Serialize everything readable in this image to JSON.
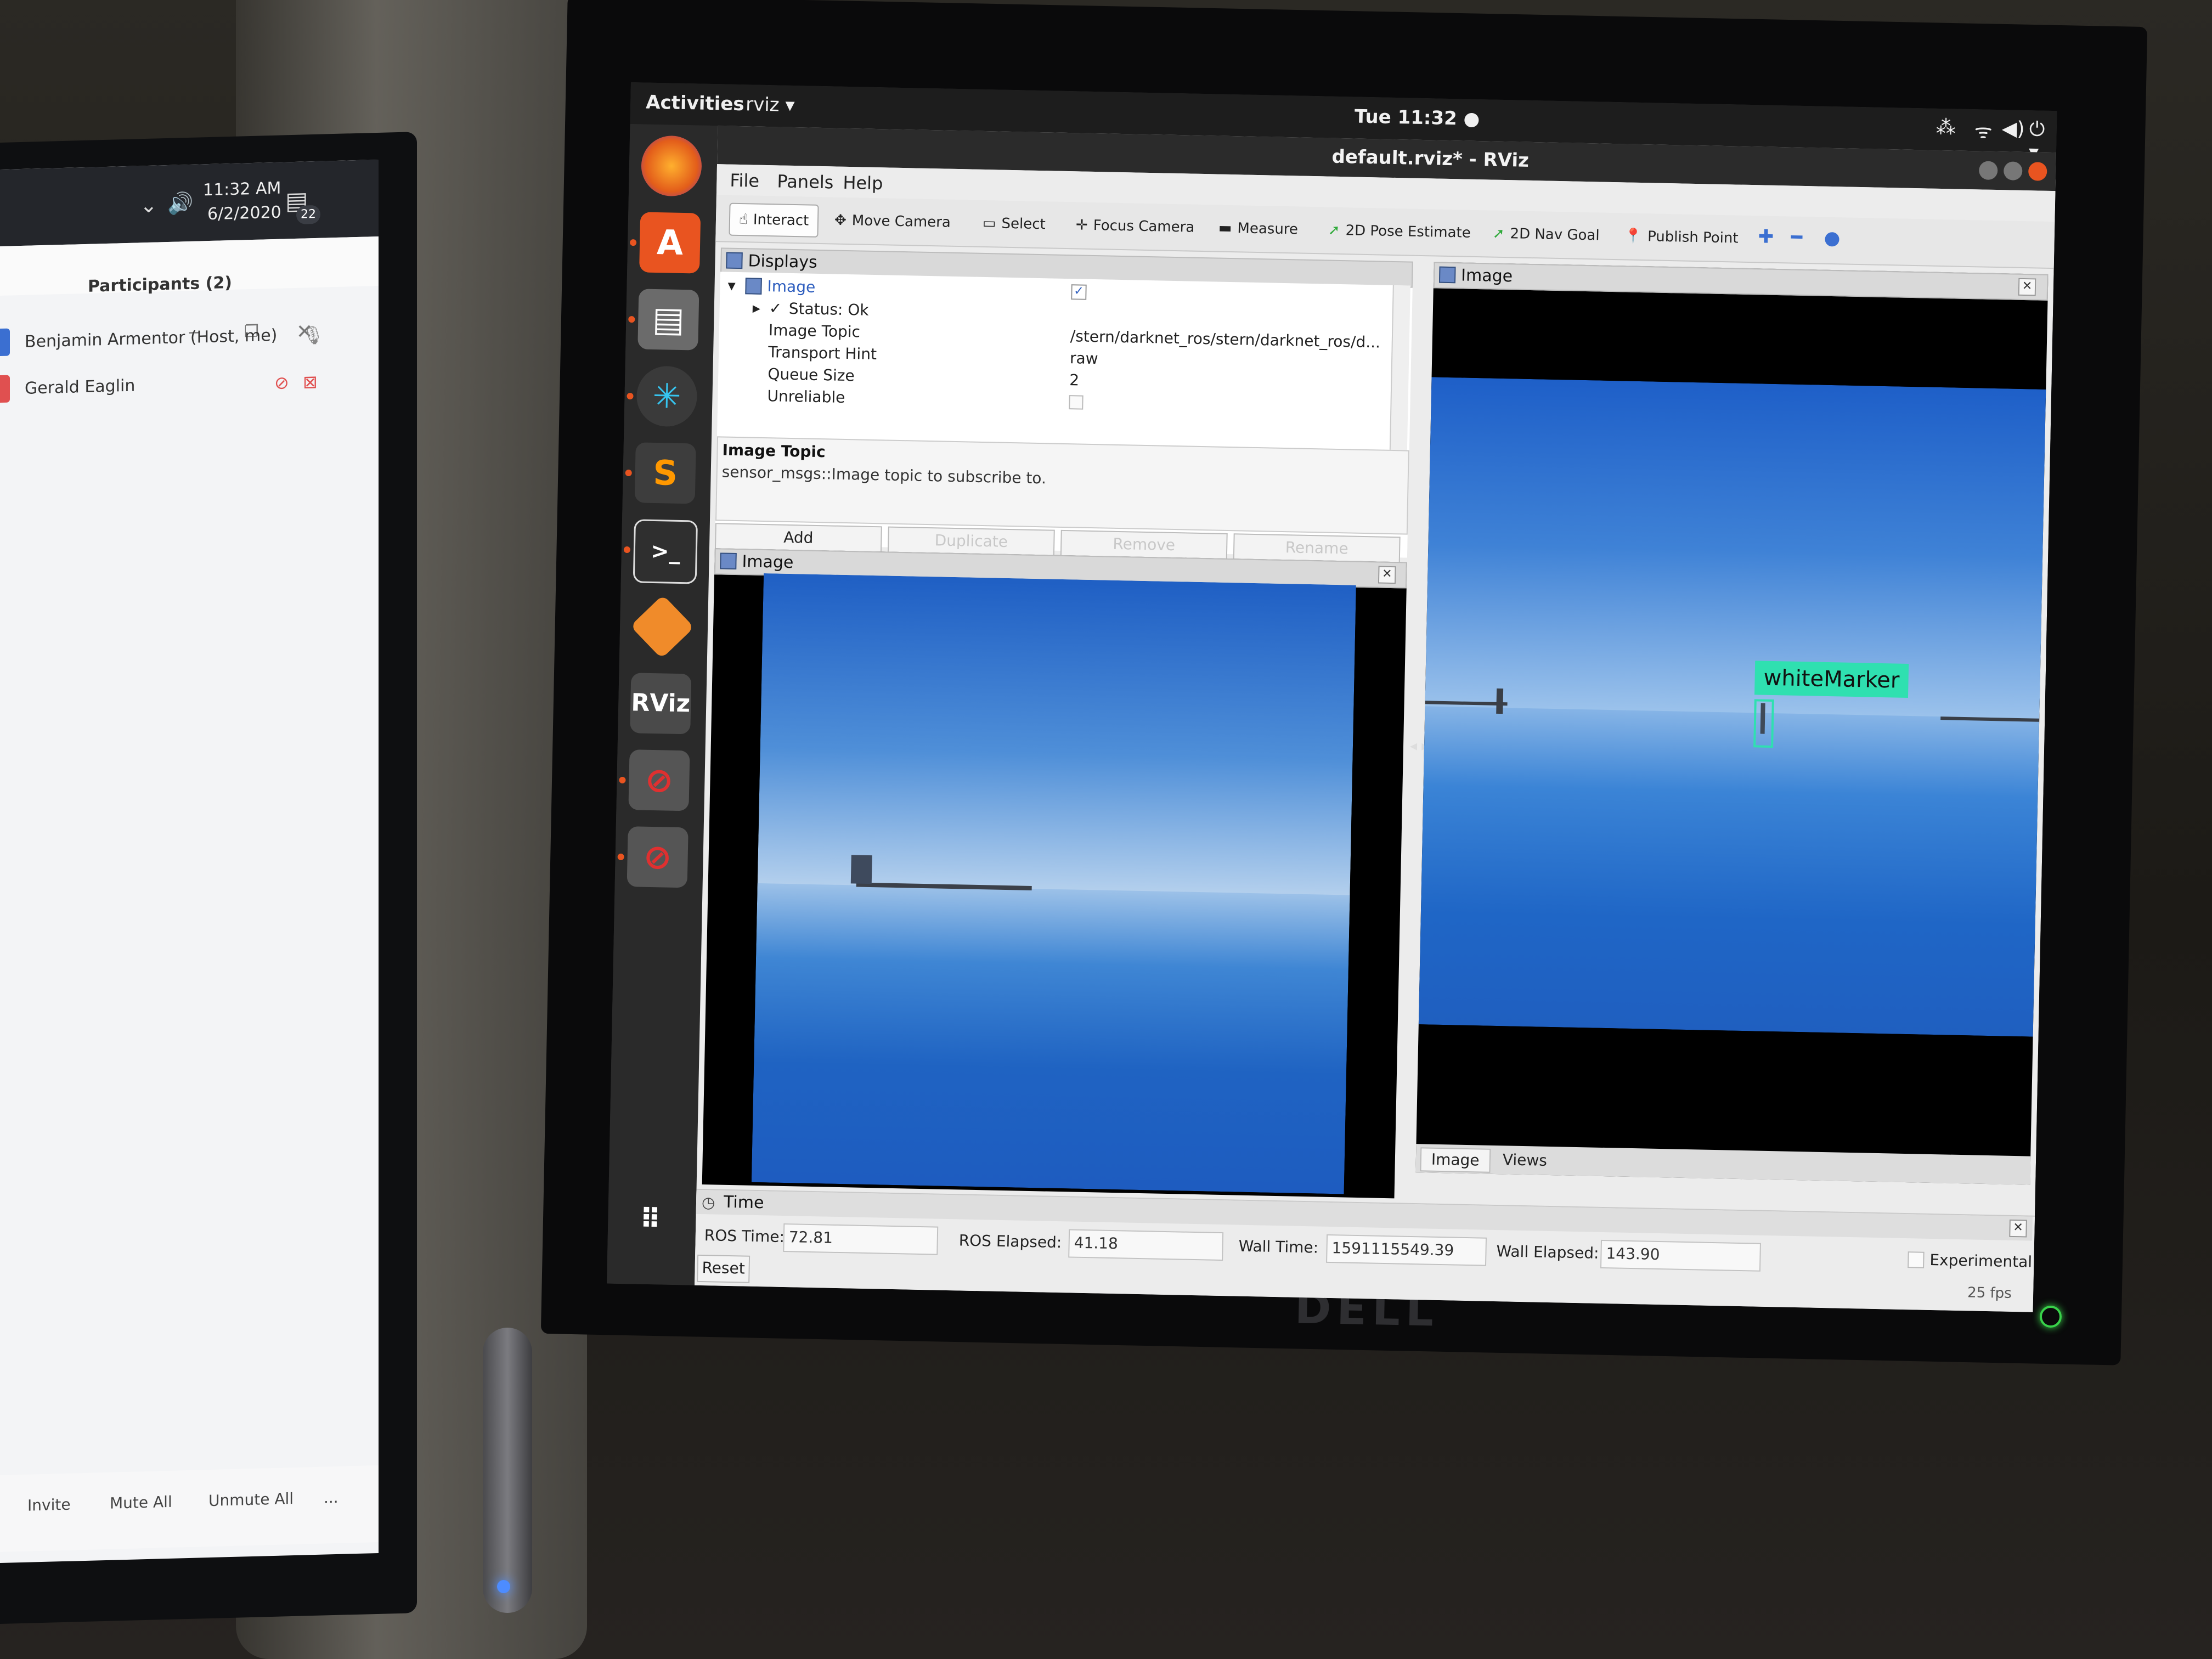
{
  "left_monitor": {
    "tray": {
      "time": "11:32 AM",
      "date": "6/2/2020",
      "badge": "22"
    },
    "participants_title": "Participants (2)",
    "participants": [
      {
        "name": "Benjamin Armentor (Host, me)",
        "avatar_color": "#3b6fd1"
      },
      {
        "name": "Gerald Eaglin",
        "avatar_color": "#e05050"
      }
    ],
    "footer": {
      "invite": "Invite",
      "mute_all": "Mute All",
      "unmute_all": "Unmute All",
      "more": "..."
    }
  },
  "gnome": {
    "activities": "Activities",
    "app_menu": "rviz ▾",
    "clock": "Tue 11:32 ●"
  },
  "dock_icons": [
    "firefox-icon",
    "software-icon",
    "files-icon",
    "slack-icon",
    "sublime-icon",
    "terminal-icon",
    "qt-icon",
    "rviz-icon",
    "blocked-icon",
    "blocked-icon",
    "apps-grid-icon"
  ],
  "rviz": {
    "title": "default.rviz* - RViz",
    "menu": {
      "file": "File",
      "panels": "Panels",
      "help": "Help"
    },
    "toolbar": {
      "interact": "Interact",
      "move_camera": "Move Camera",
      "select": "Select",
      "focus_camera": "Focus Camera",
      "measure": "Measure",
      "pose_estimate": "2D Pose Estimate",
      "nav_goal": "2D Nav Goal",
      "publish_point": "Publish Point"
    },
    "displays": {
      "header": "Displays",
      "tree": {
        "image": "Image",
        "status": "Status: Ok",
        "image_topic_label": "Image Topic",
        "image_topic_value": "/stern/darknet_ros/stern/darknet_ros/d...",
        "transport_hint_label": "Transport Hint",
        "transport_hint_value": "raw",
        "queue_size_label": "Queue Size",
        "queue_size_value": "2",
        "unreliable_label": "Unreliable"
      },
      "description_title": "Image Topic",
      "description_text": "sensor_msgs::Image topic to subscribe to.",
      "buttons": {
        "add": "Add",
        "duplicate": "Duplicate",
        "remove": "Remove",
        "rename": "Rename"
      }
    },
    "image_left_header": "Image",
    "image_right_header": "Image",
    "detection_label": "whiteMarker",
    "right_tabs": {
      "image": "Image",
      "views": "Views"
    },
    "time": {
      "header": "Time",
      "ros_time_label": "ROS Time:",
      "ros_time_value": "72.81",
      "ros_elapsed_label": "ROS Elapsed:",
      "ros_elapsed_value": "41.18",
      "wall_time_label": "Wall Time:",
      "wall_time_value": "1591115549.39",
      "wall_elapsed_label": "Wall Elapsed:",
      "wall_elapsed_value": "143.90",
      "experimental": "Experimental",
      "reset": "Reset",
      "fps": "25 fps"
    }
  },
  "monitor_brand": "DELL"
}
